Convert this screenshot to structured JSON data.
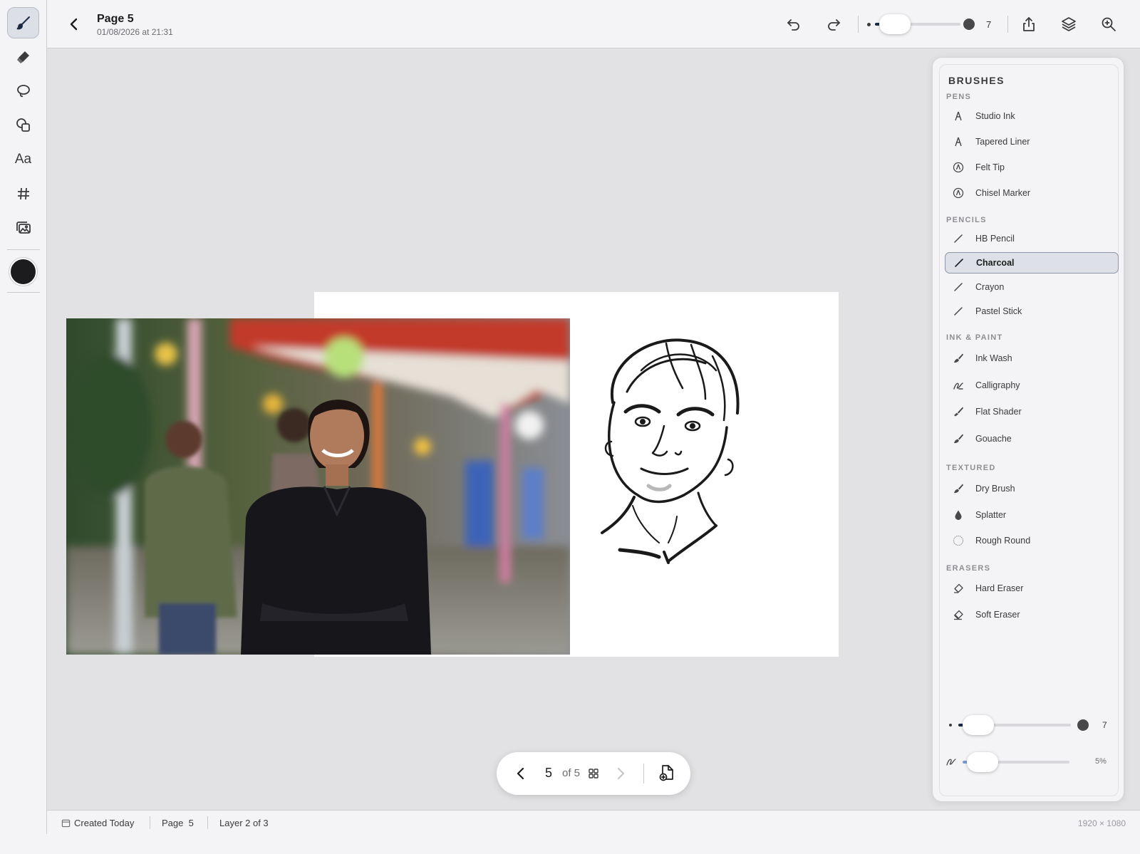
{
  "header": {
    "title": "Page 5",
    "subtitle": "01/08/2026 at 21:31",
    "brush_size_value": "7",
    "brush_size_fraction": 0.05
  },
  "tools": [
    "brush-icon",
    "eraser-icon",
    "lasso-icon",
    "shapes-icon",
    "text-tool",
    "grid-icon",
    "image-icon"
  ],
  "tools_text_label": "Aa",
  "current_color": "#1c1c1e",
  "panel": {
    "title": "BRUSHES",
    "groups": [
      {
        "title": "PENS",
        "items": [
          "Studio Ink",
          "Tapered Liner",
          "Felt Tip",
          "Chisel Marker"
        ]
      },
      {
        "title": "PENCILS",
        "items": [
          "HB Pencil",
          "Charcoal",
          "Crayon",
          "Pastel Stick"
        ]
      },
      {
        "title": "INK & PAINT",
        "items": [
          "Ink Wash",
          "Calligraphy",
          "Flat Shader",
          "Gouache"
        ]
      },
      {
        "title": "TEXTURED",
        "items": [
          "Dry Brush",
          "Splatter",
          "Rough Round"
        ]
      },
      {
        "title": "ERASERS",
        "items": [
          "Hard Eraser",
          "Soft Eraser"
        ]
      }
    ],
    "selected": "Charcoal",
    "size_value": "7",
    "opacity_value": "5%"
  },
  "pager": {
    "current": "5",
    "of_label": "of 5"
  },
  "status": {
    "created": "Created Today",
    "page": "Page  5",
    "layer": "Layer 2 of 3",
    "dimensions": "1920 × 1080"
  }
}
